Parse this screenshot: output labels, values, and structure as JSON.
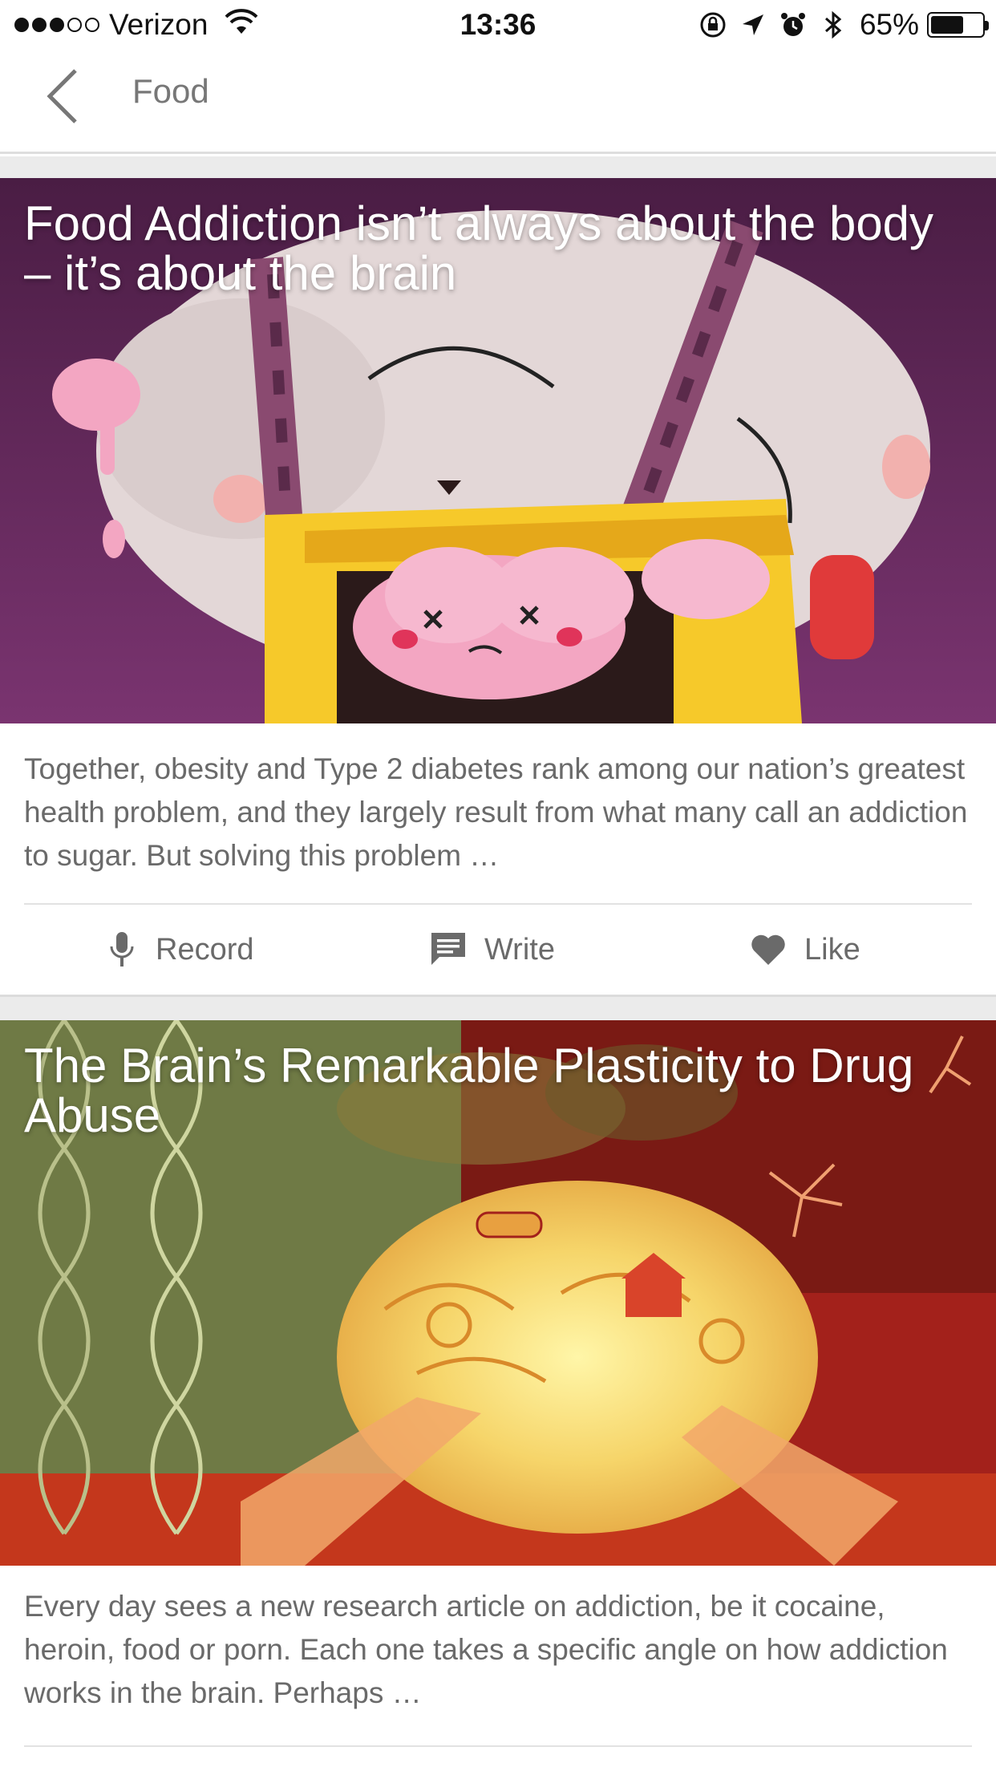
{
  "status_bar": {
    "carrier": "Verizon",
    "time": "13:36",
    "battery_percent": "65%",
    "battery_level": 0.65,
    "signal_bars_filled": 3,
    "signal_bars_total": 5
  },
  "nav": {
    "title": "Food",
    "back_icon": "chevron-left-icon"
  },
  "cards": [
    {
      "title": "Food Addiction isn’t always about the body – it’s about the brain",
      "excerpt": "Together, obesity and Type 2 diabetes rank among our nation’s greatest health problem, and they largely result from what many call an addiction to sugar. But solving this problem …",
      "image": "illustration of a brain inside an open treasure chest"
    },
    {
      "title": "The Brain’s Remarkable Plasticity to Drug Abuse",
      "excerpt": "Every day sees a new research article on addiction, be it cocaine, heroin, food or porn. Each one takes a specific angle on how addiction works in the brain. Perhaps …",
      "image": "illustration of a glowing brain with neurons and DNA strands"
    }
  ],
  "actions": {
    "record_label": "Record",
    "write_label": "Write",
    "like_label": "Like"
  },
  "colors": {
    "card1_bg": "#6a2a5c",
    "card2_bg_left": "#6f7a45",
    "card2_bg_right": "#a3211b",
    "accent_yellow": "#f6c92a"
  }
}
